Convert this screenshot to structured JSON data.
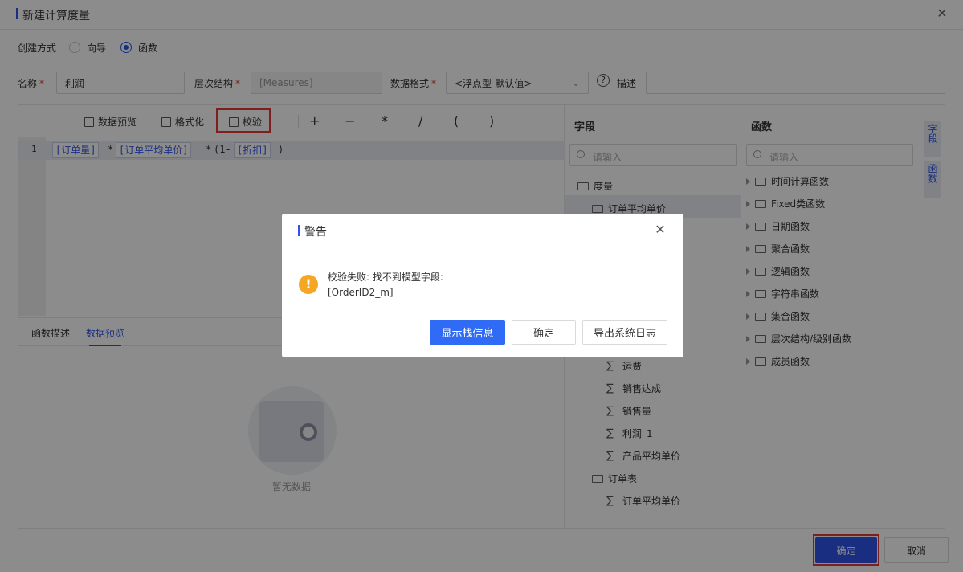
{
  "dialog": {
    "title": "新建计算度量",
    "close_icon": "close-icon"
  },
  "create_mode": {
    "label": "创建方式",
    "options": [
      {
        "label": "向导",
        "selected": false
      },
      {
        "label": "函数",
        "selected": true
      }
    ]
  },
  "form": {
    "name_label": "名称",
    "name_value": "利润",
    "hierarchy_label": "层次结构",
    "hierarchy_value": "[Measures]",
    "format_label": "数据格式",
    "format_value": "<浮点型-默认值>",
    "desc_label": "描述",
    "desc_value": "",
    "required_mark": "*",
    "help_icon": "?"
  },
  "toolbar": {
    "preview_label": "数据预览",
    "format_label": "格式化",
    "validate_label": "校验",
    "operators": [
      "+",
      "−",
      "*",
      "/",
      "(",
      ")"
    ]
  },
  "editor": {
    "line_number": "1",
    "tokens": {
      "t1": "[订单量]",
      "t2": "*",
      "t3": "[订单平均单价]",
      "t4": "*",
      "t5": "(1-",
      "t6": "[折扣]",
      "t7": ")"
    }
  },
  "bottom_tabs": {
    "func_desc": "函数描述",
    "data_preview": "数据预览",
    "active": "数据预览"
  },
  "empty": {
    "text": "暂无数据"
  },
  "fields_panel": {
    "title": "字段",
    "search_placeholder": "请输入",
    "items": {
      "measures": "度量",
      "avg_price": "订单平均单价",
      "freight": "运费",
      "sales_achieve": "销售达成",
      "sales_qty": "销售量",
      "profit_1": "利润_1",
      "product_avg_price": "产品平均单价",
      "order_table": "订单表",
      "order_avg_price": "订单平均单价"
    }
  },
  "functions_panel": {
    "title": "函数",
    "search_placeholder": "请输入",
    "items": [
      "时间计算函数",
      "Fixed类函数",
      "日期函数",
      "聚合函数",
      "逻辑函数",
      "字符串函数",
      "集合函数",
      "层次结构/级别函数",
      "成员函数"
    ]
  },
  "side_tabs": {
    "fields": "字段",
    "functions": "函数"
  },
  "footer": {
    "ok_label": "确定",
    "cancel_label": "取消"
  },
  "alert": {
    "title": "警告",
    "message_line1": "校验失败: 找不到模型字段:",
    "message_line2": "[OrderID2_m]",
    "icon": "!",
    "show_stack_label": "显示栈信息",
    "ok_label": "确定",
    "export_log_label": "导出系统日志"
  },
  "colors": {
    "accent": "#2f54eb",
    "primary_button": "#2f6bf5",
    "warning": "#f5a623",
    "highlight": "#e53935"
  }
}
